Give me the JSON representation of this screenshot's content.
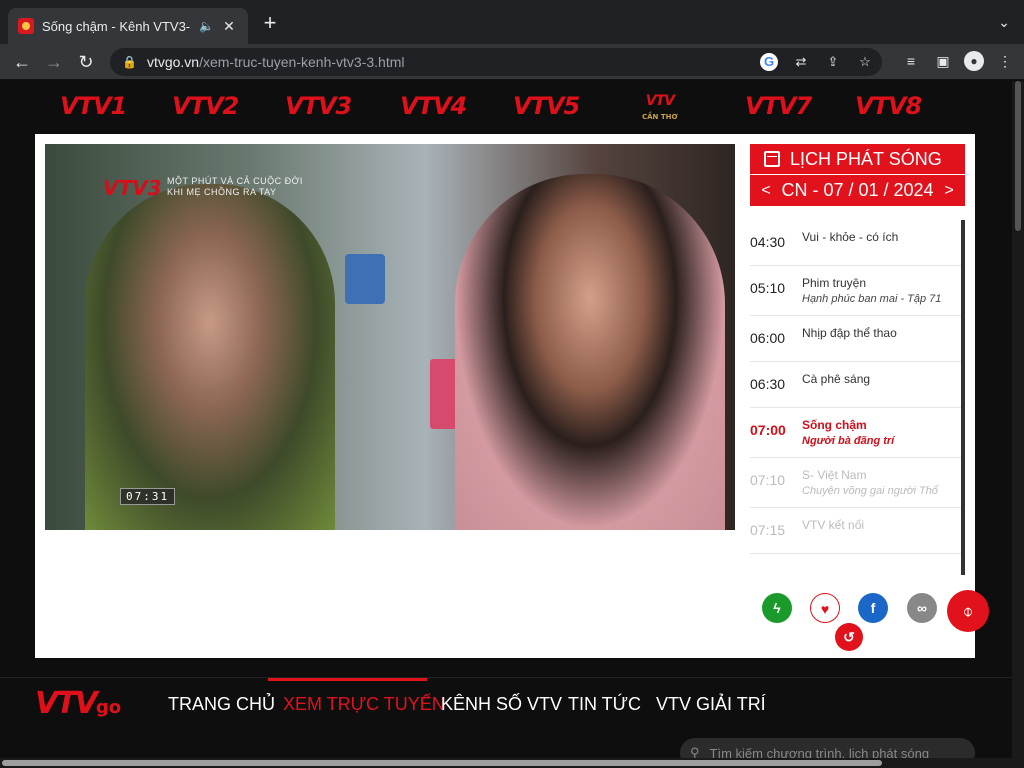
{
  "browser": {
    "tab_title": "Sống chậm - Kênh VTV3-",
    "tab_audio_icon": "speaker-icon",
    "url_domain": "vtvgo.vn",
    "url_path": "/xem-truc-tuyen-kenh-vtv3-3.html"
  },
  "channels": [
    {
      "label": "VTV1"
    },
    {
      "label": "VTV2"
    },
    {
      "label": "VTV3"
    },
    {
      "label": "VTV4"
    },
    {
      "label": "VTV5"
    },
    {
      "label": "VTV",
      "sub": "CẦN THƠ"
    },
    {
      "label": "VTV7"
    },
    {
      "label": "VTV8"
    }
  ],
  "player": {
    "watermark_logo": "VTV3",
    "watermark_line1": "MỘT PHÚT VÀ CẢ CUỘC ĐỜI",
    "watermark_line2": "KHI MẸ CHỒNG RA TAY",
    "timecode": "07:31"
  },
  "schedule": {
    "title": "LỊCH PHÁT SÓNG",
    "date": "CN - 07 / 01 / 2024",
    "prev": "<",
    "next": ">",
    "items": [
      {
        "time": "04:30",
        "name": "Vui - khỏe - có ích",
        "sub": ""
      },
      {
        "time": "05:10",
        "name": "Phim truyện",
        "sub": "Hạnh phúc ban mai - Tập 71"
      },
      {
        "time": "06:00",
        "name": "Nhịp đập thể thao",
        "sub": ""
      },
      {
        "time": "06:30",
        "name": "Cà phê sáng",
        "sub": ""
      },
      {
        "time": "07:00",
        "name": "Sống chậm",
        "sub": "Người bà đãng trí"
      },
      {
        "time": "07:10",
        "name": "S- Việt Nam",
        "sub": "Chuyện võng gai người Thổ"
      },
      {
        "time": "07:15",
        "name": "VTV kết nối",
        "sub": ""
      }
    ]
  },
  "actions": {
    "colors": {
      "flash": "#1a9a2a",
      "heart": "#e1121c",
      "facebook": "#1b67c8",
      "link": "#888888",
      "refresh": "#e1121c"
    }
  },
  "nav": {
    "logo": "VTV",
    "logo_go": "go",
    "links": [
      "TRANG CHỦ",
      "XEM TRỰC TUYẾN",
      "KÊNH SỐ VTV",
      "TIN TỨC",
      "VTV GIẢI TRÍ"
    ],
    "search_placeholder": "Tìm kiếm chương trình, lịch phát sóng"
  }
}
